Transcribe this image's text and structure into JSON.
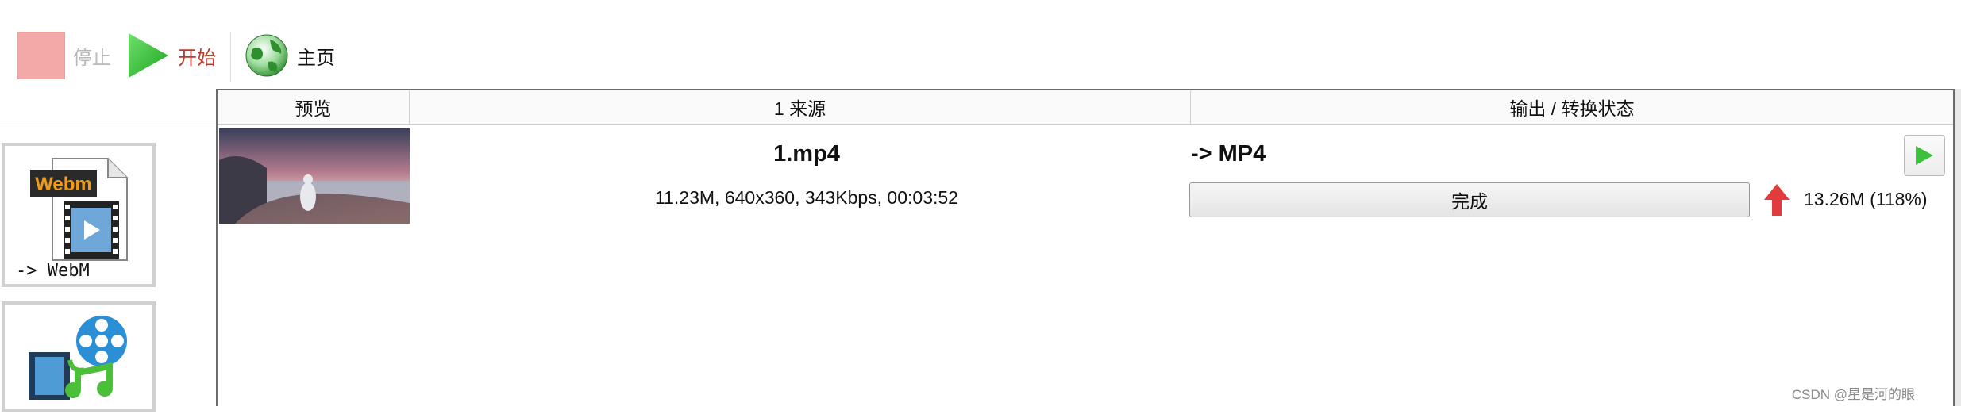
{
  "toolbar": {
    "stop_label": "停止",
    "start_label": "开始",
    "home_label": "主页",
    "colors": {
      "stop_label": "#b8b8b8",
      "start_label": "#c0392b",
      "home_label": "#111111"
    }
  },
  "sidebar": {
    "formats": [
      {
        "badge": "Webm",
        "label": "-> WebM",
        "icon": "webm-file-icon"
      },
      {
        "label": "",
        "icon": "video-to-audio-icon"
      }
    ]
  },
  "table": {
    "columns": [
      "预览",
      "1 来源",
      "输出 / 转换状态"
    ],
    "rows": [
      {
        "source_name": "1.mp4",
        "source_info": "11.23M, 640x360, 343Kbps, 00:03:52",
        "output_format": "-> MP4",
        "status": "完成",
        "output_size": "13.26M  (118%)"
      }
    ]
  },
  "watermark": "CSDN @星是河的眼",
  "colors": {
    "accent_green": "#3cc13c",
    "arrow_red": "#e23b3b"
  }
}
